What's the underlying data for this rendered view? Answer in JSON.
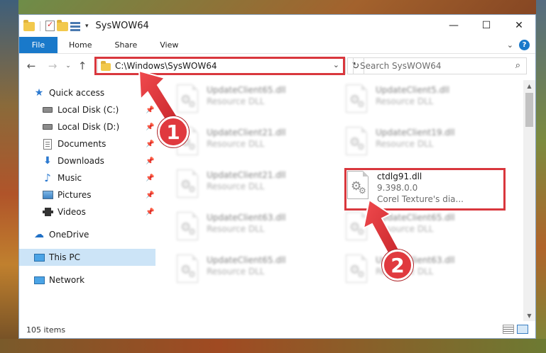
{
  "window": {
    "title": "SysWOW64",
    "controls": {
      "minimize": "—",
      "maximize": "☐",
      "close": "✕"
    }
  },
  "ribbon": {
    "tabs": [
      "File",
      "Home",
      "Share",
      "View"
    ],
    "help": "?"
  },
  "nav": {
    "address": "C:\\Windows\\SysWOW64",
    "search_placeholder": "Search SysWOW64"
  },
  "sidebar": {
    "items": [
      {
        "label": "Quick access",
        "icon": "star-icon"
      },
      {
        "label": "Local Disk (C:)",
        "icon": "drive-icon",
        "pinned": true
      },
      {
        "label": "Local Disk (D:)",
        "icon": "drive-icon",
        "pinned": true
      },
      {
        "label": "Documents",
        "icon": "documents-icon",
        "pinned": true
      },
      {
        "label": "Downloads",
        "icon": "download-icon",
        "pinned": true
      },
      {
        "label": "Music",
        "icon": "music-icon",
        "pinned": true
      },
      {
        "label": "Pictures",
        "icon": "pictures-icon",
        "pinned": true
      },
      {
        "label": "Videos",
        "icon": "videos-icon",
        "pinned": true
      },
      {
        "label": "OneDrive",
        "icon": "cloud-icon"
      },
      {
        "label": "This PC",
        "icon": "computer-icon",
        "selected": true
      },
      {
        "label": "Network",
        "icon": "network-icon"
      }
    ]
  },
  "files": [
    {
      "name": "UpdateClient65.dll",
      "sub": "Resource DLL",
      "blurred": true
    },
    {
      "name": "UpdateClient5.dll",
      "sub": "Resource DLL",
      "blurred": true
    },
    {
      "name": "UpdateClient21.dll",
      "sub": "Resource DLL",
      "blurred": true
    },
    {
      "name": "UpdateClient19.dll",
      "sub": "Resource DLL",
      "blurred": true
    },
    {
      "name": "UpdateClient21.dll",
      "sub": "Resource DLL",
      "blurred": true
    },
    {
      "name": "ctdlg91.dll",
      "sub": "9.398.0.0",
      "sub2": "Corel Texture's dia...",
      "blurred": false
    },
    {
      "name": "UpdateClient63.dll",
      "sub": "Resource DLL",
      "blurred": true
    },
    {
      "name": "UpdateClient65.dll",
      "sub": "Resource DLL",
      "blurred": true
    },
    {
      "name": "UpdateClient65.dll",
      "sub": "Resource DLL",
      "blurred": true
    },
    {
      "name": "UpdateClient63.dll",
      "sub": "Resource DLL",
      "blurred": true
    }
  ],
  "status": {
    "item_count": "105 items"
  },
  "annotations": {
    "step1": "1",
    "step2": "2"
  },
  "colors": {
    "accent": "#1979ca",
    "highlight": "#d9373d",
    "selected": "#cce4f7"
  }
}
